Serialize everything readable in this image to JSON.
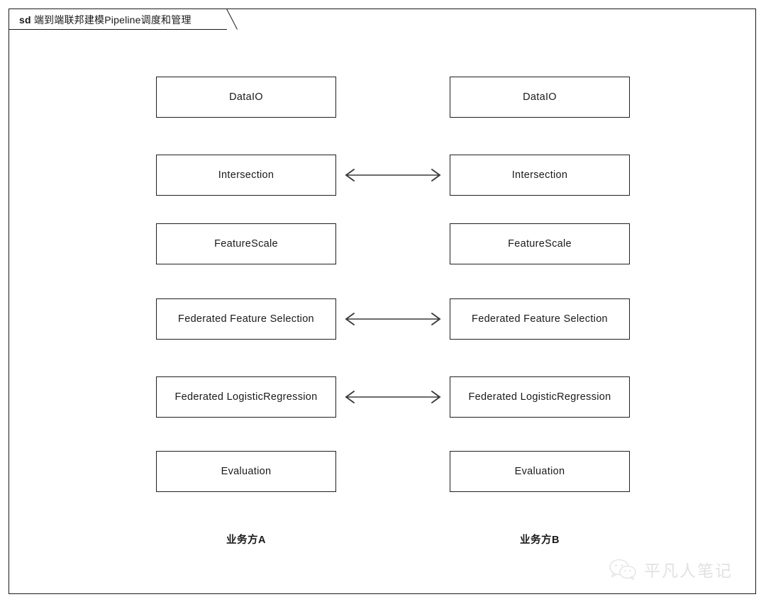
{
  "frame": {
    "kind": "sd",
    "title": "端到端联邦建模Pipeline调度和管理"
  },
  "diagram": {
    "type": "sequence-diagram",
    "columns": [
      {
        "id": "party-a",
        "caption": "业务方A",
        "steps": [
          "DataIO",
          "Intersection",
          "FeatureScale",
          "Federated Feature Selection",
          "Federated LogisticRegression",
          "Evaluation"
        ]
      },
      {
        "id": "party-b",
        "caption": "业务方B",
        "steps": [
          "DataIO",
          "Intersection",
          "FeatureScale",
          "Federated Feature Selection",
          "Federated LogisticRegression",
          "Evaluation"
        ]
      }
    ],
    "links": [
      {
        "row": 1,
        "direction": "bidirectional",
        "label": ""
      },
      {
        "row": 3,
        "direction": "bidirectional",
        "label": ""
      },
      {
        "row": 4,
        "direction": "bidirectional",
        "label": ""
      }
    ]
  },
  "watermark": {
    "text": "平凡人笔记",
    "icon": "wechat-icon"
  },
  "colors": {
    "border": "#1f1f1f",
    "frame_border": "#1a1a1a",
    "text": "#1a1a1a",
    "arrow": "#3a3a3a",
    "background": "#ffffff",
    "watermark": "#b9b9b9"
  }
}
